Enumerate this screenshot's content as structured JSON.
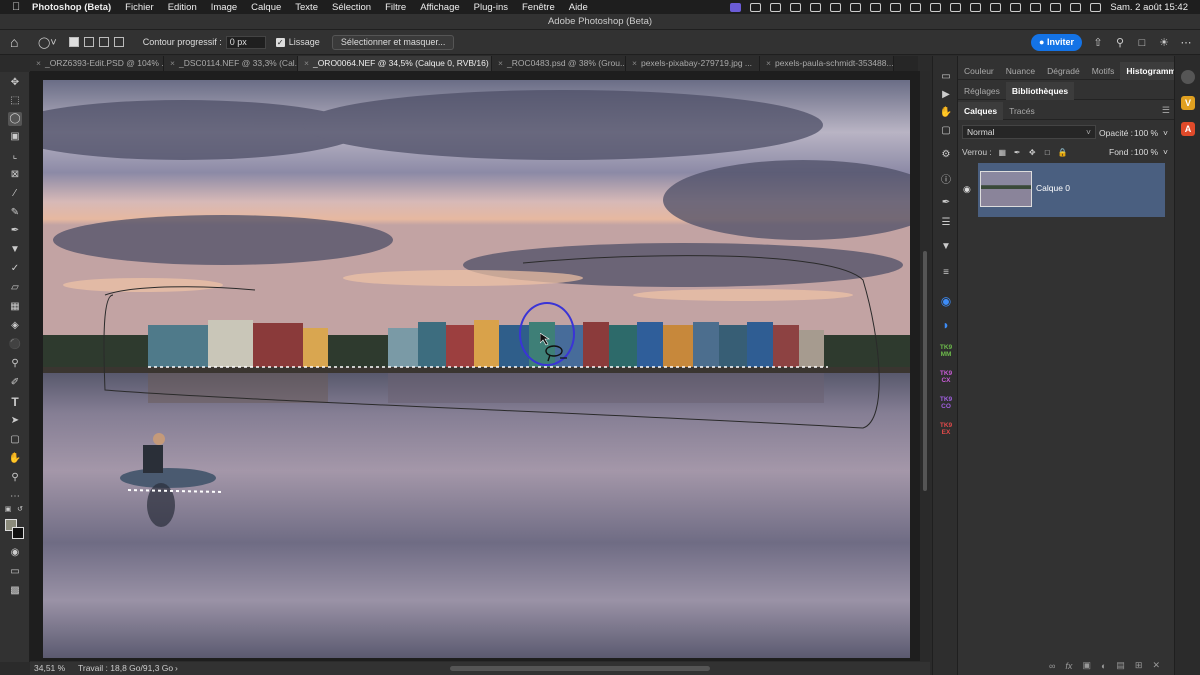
{
  "menubar": {
    "app_name": "Photoshop (Beta)",
    "items": [
      "Fichier",
      "Edition",
      "Image",
      "Calque",
      "Texte",
      "Sélection",
      "Filtre",
      "Affichage",
      "Plug-ins",
      "Fenêtre",
      "Aide"
    ],
    "clock": "Sam. 2 août  15:42"
  },
  "window": {
    "title": "Adobe Photoshop (Beta)"
  },
  "options": {
    "feather_label": "Contour progressif :",
    "feather_value": "0 px",
    "smoothing_label": "Lissage",
    "select_mask_label": "Sélectionner et masquer...",
    "invite_label": "Inviter"
  },
  "tabs": [
    {
      "label": "_ORZ6393-Edit.PSD @ 104% ..."
    },
    {
      "label": "_DSC0114.NEF @ 33,3% (Cal..."
    },
    {
      "label": "_ORO0064.NEF @ 34,5% (Calque 0, RVB/16) *"
    },
    {
      "label": "_ROC0483.psd @ 38% (Grou..."
    },
    {
      "label": "pexels-pixabay-279719.jpg ..."
    },
    {
      "label": "pexels-paula-schmidt-353488..."
    }
  ],
  "statusbar": {
    "zoom": "34,51 %",
    "doc_info": "Travail : 18,8 Go/91,3 Go",
    "arrow": "›"
  },
  "panels": {
    "top_tabs": [
      "Couleur",
      "Nuance",
      "Dégradé",
      "Motifs",
      "Histogramme"
    ],
    "second_tabs": [
      "Réglages",
      "Bibliothèques"
    ],
    "layer_tabs": [
      "Calques",
      "Tracés"
    ],
    "blend_mode": "Normal",
    "opacity_label": "Opacité :",
    "opacity_value": "100 %",
    "lock_label": "Verrou :",
    "fill_label": "Fond :",
    "fill_value": "100 %",
    "layer_name": "Calque 0",
    "strip_tk_labels": [
      "TK9\nMM",
      "TK9\nCX",
      "TK9\nCO",
      "TK9\nEX"
    ],
    "far_icons": [
      "V",
      "A"
    ]
  },
  "colors": {
    "accent_blue": "#1473e6",
    "cursor_ring": "#3a34d6",
    "layer_selected": "#4a5f80"
  }
}
